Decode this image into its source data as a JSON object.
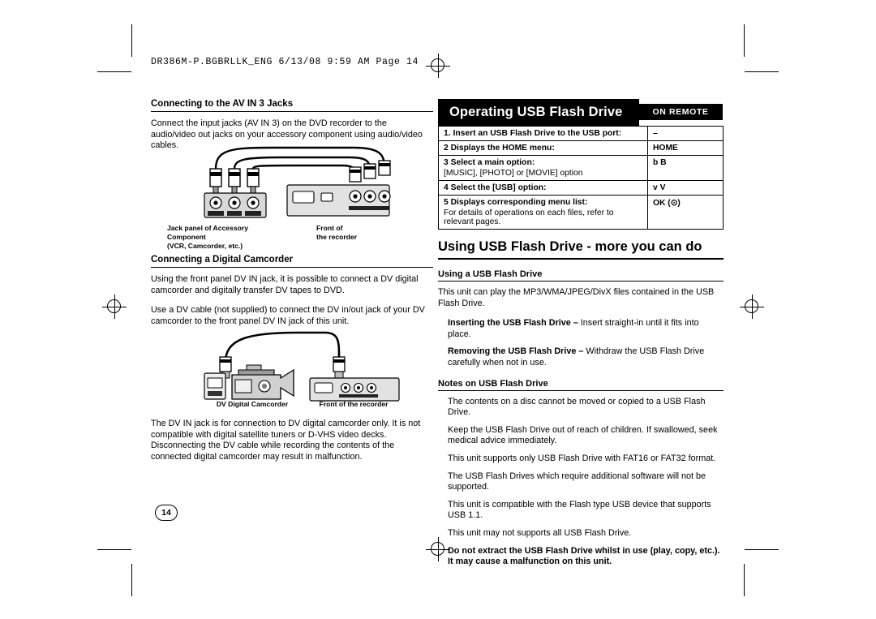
{
  "file_header": "DR386M-P.BGBRLLK_ENG  6/13/08  9:59 AM  Page 14",
  "page_number": "14",
  "left": {
    "section1_title": "Connecting to the AV IN 3 Jacks",
    "section1_p1": "Connect the input jacks (AV IN 3) on the DVD recorder to the audio/video out jacks on your accessory component using audio/video cables.",
    "fig1_caption_left": "Jack panel of Accessory Component\n(VCR, Camcorder, etc.)",
    "fig1_caption_left_l1": "Jack panel of Accessory",
    "fig1_caption_left_l2": "Component",
    "fig1_caption_left_l3": "(VCR, Camcorder, etc.)",
    "fig1_caption_right_l1": "Front of",
    "fig1_caption_right_l2": "the recorder",
    "section2_title": "Connecting a Digital Camcorder",
    "section2_p1": "Using the front panel DV IN jack, it is possible to connect a DV digital camcorder and digitally transfer DV tapes to DVD.",
    "section2_p2": "Use a DV cable (not supplied) to connect the DV in/out jack of your DV camcorder to the front panel DV IN jack of this unit.",
    "fig2_caption_left": "DV Digital Camcorder",
    "fig2_caption_right": "Front of the recorder",
    "section2_p3": "The DV IN jack is for connection to DV digital camcorder only. It is not compatible with digital satellite tuners or D-VHS video decks. Disconnecting the DV cable while recording the contents of the connected digital camcorder may result in malfunction."
  },
  "right": {
    "banner_title": "Operating USB Flash Drive",
    "remote_header": "ON REMOTE",
    "remote_rows": [
      {
        "num": "1.",
        "action": "Insert an USB Flash Drive to the USB port:",
        "sub": "",
        "key": "–"
      },
      {
        "num": "2",
        "action": "Displays the HOME menu:",
        "sub": "",
        "key": "HOME"
      },
      {
        "num": "3",
        "action": "Select a main option:",
        "sub": "[MUSIC], [PHOTO] or [MOVIE] option",
        "key": "b B"
      },
      {
        "num": "4",
        "action": "Select the [USB] option:",
        "sub": "",
        "key": "v V"
      },
      {
        "num": "5",
        "action": "Displays corresponding menu list:",
        "sub": "For details of operations on each files, refer to relevant pages.",
        "key": "OK (⊙)"
      }
    ],
    "banner2_title": "Using USB Flash Drive - more you can do",
    "sub_head_1": "Using a USB Flash Drive",
    "p1": "This unit can play the MP3/WMA/JPEG/DivX files contained in the USB Flash Drive.",
    "b1_bold": "Inserting the USB Flash Drive –",
    "b1_rest": " Insert straight-in until it fits into place.",
    "b2_bold": "Removing the USB Flash Drive –",
    "b2_rest": " Withdraw the USB Flash Drive carefully when not in use.",
    "sub_head_2": "Notes on USB Flash Drive",
    "notes": [
      "The contents on a disc cannot be moved or copied to a USB Flash Drive.",
      "Keep the USB Flash Drive out of reach of children. If swallowed, seek medical advice immediately.",
      "This unit supports only USB Flash Drive with FAT16 or FAT32 format.",
      "The USB Flash Drives which require additional software will not be supported.",
      "This unit is compatible with the Flash type USB device that supports USB 1.1.",
      "This unit may not supports all USB Flash Drive."
    ],
    "warning_l1": "Do not extract the USB Flash Drive whilst in use (play, copy, etc.).",
    "warning_l2": "It may cause a malfunction on this unit."
  }
}
